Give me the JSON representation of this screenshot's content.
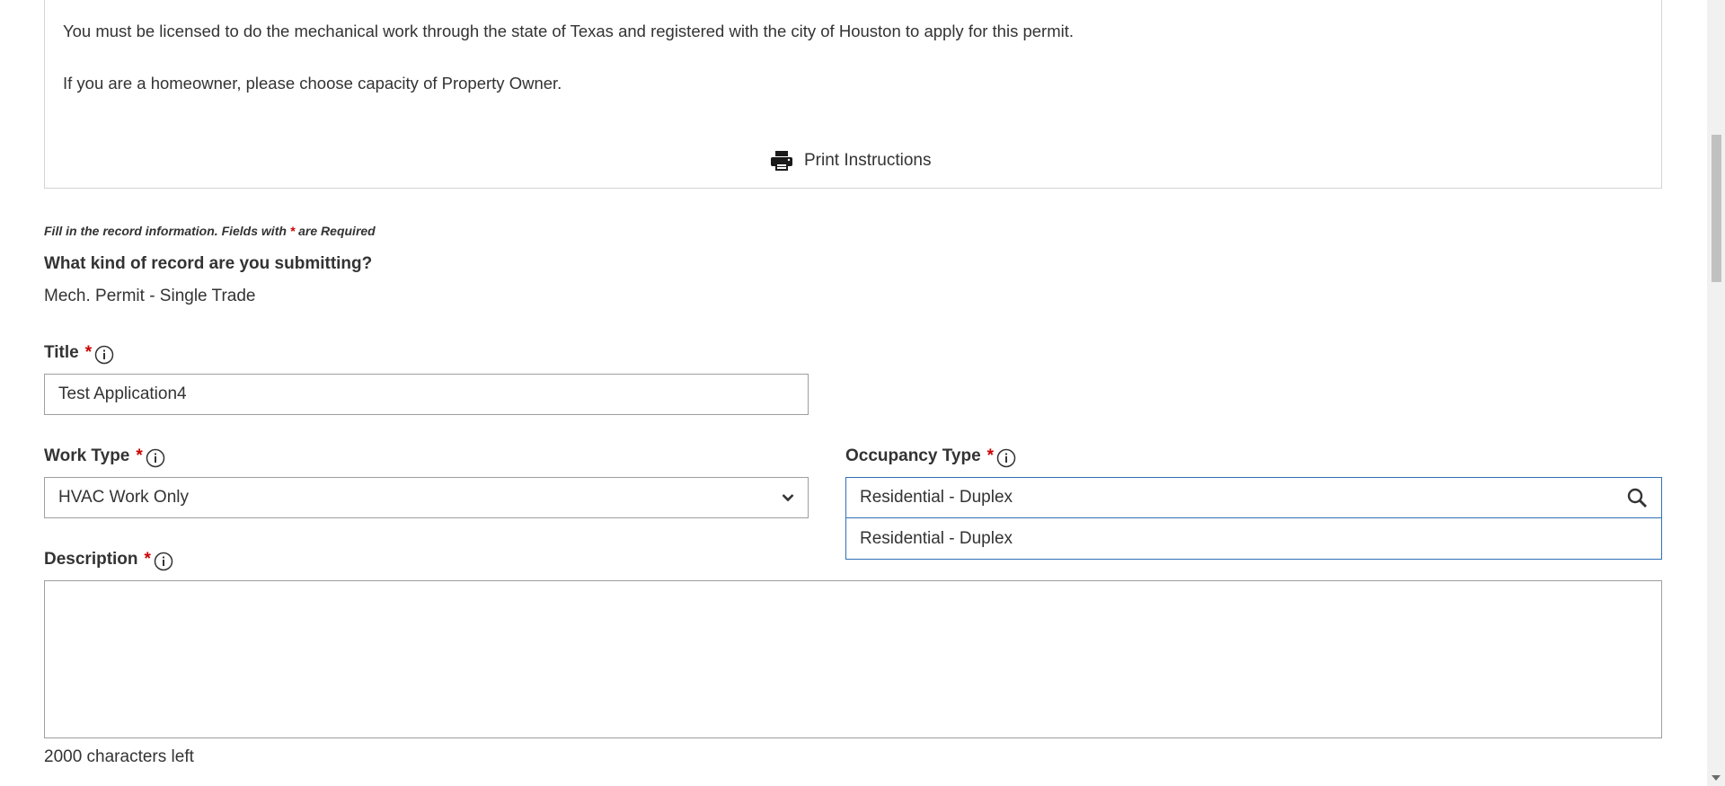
{
  "instructions": {
    "line1": "You must be licensed to do the mechanical work through the state of Texas and registered with the city of Houston to apply for this permit.",
    "line2": "If you are a homeowner, please choose capacity of Property Owner.",
    "print_label": "Print Instructions"
  },
  "form": {
    "required_note_prefix": "Fill in the record information. Fields with ",
    "required_note_star": "*",
    "required_note_suffix": " are Required",
    "record_question": "What kind of record are you submitting?",
    "record_type": "Mech. Permit - Single Trade",
    "title": {
      "label": "Title",
      "required_mark": "*",
      "value": "Test Application4"
    },
    "work_type": {
      "label": "Work Type",
      "required_mark": "*",
      "value": "HVAC Work Only"
    },
    "occupancy_type": {
      "label": "Occupancy Type",
      "required_mark": "*",
      "value": "Residential - Duplex",
      "options": [
        "Residential - Duplex"
      ]
    },
    "description": {
      "label": "Description",
      "required_mark": "*",
      "value": "",
      "chars_left": "2000 characters left"
    }
  },
  "icons": {
    "print": "printer-icon",
    "info": "info-icon",
    "chevron": "chevron-down-icon",
    "search": "search-icon"
  },
  "colors": {
    "required_star": "#cc0000",
    "focus_border": "#2f6fb5",
    "text": "#333333",
    "border": "#9e9e9e"
  }
}
